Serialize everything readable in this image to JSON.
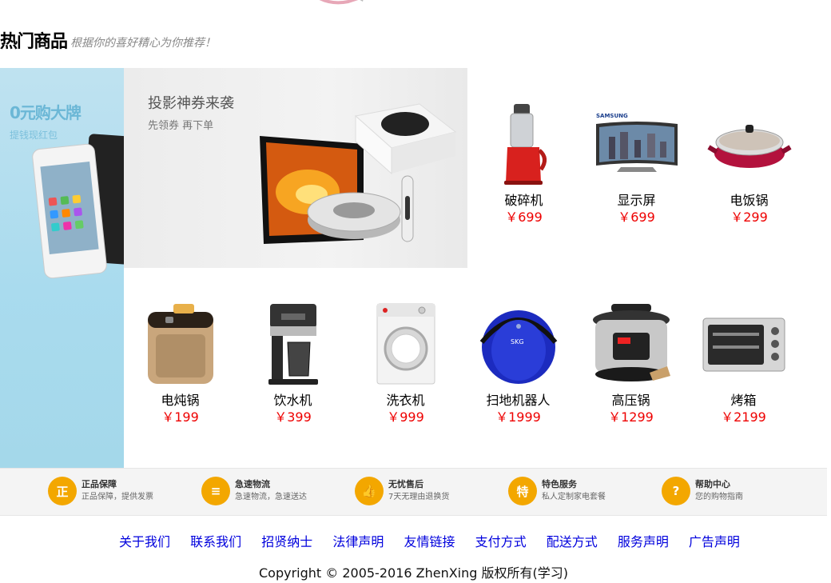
{
  "section": {
    "title": "热门商品",
    "slogan": "根据你的喜好精心为你推荐！"
  },
  "left_banner": {
    "title": "0元购大牌",
    "subtitle": "提钱现红包"
  },
  "promo_banner": {
    "title": "投影神券来袭",
    "subtitle": "先领券 再下单"
  },
  "products_row1": [
    {
      "name": "破碎机",
      "price": "￥699",
      "icon": "juicer-icon"
    },
    {
      "name": "显示屏",
      "price": "￥699",
      "icon": "monitor-icon"
    },
    {
      "name": "电饭锅",
      "price": "￥299",
      "icon": "hotpot-icon"
    }
  ],
  "products_row2": [
    {
      "name": "电炖锅",
      "price": "￥199",
      "icon": "bread-maker-icon"
    },
    {
      "name": "饮水机",
      "price": "￥399",
      "icon": "coffee-maker-icon"
    },
    {
      "name": "洗衣机",
      "price": "￥999",
      "icon": "washing-machine-icon"
    },
    {
      "name": "扫地机器人",
      "price": "￥1999",
      "icon": "robot-vacuum-icon"
    },
    {
      "name": "高压锅",
      "price": "￥1299",
      "icon": "pressure-cooker-icon"
    },
    {
      "name": "烤箱",
      "price": "￥2199",
      "icon": "oven-icon"
    }
  ],
  "services": [
    {
      "title": "正品保障",
      "desc": "正品保障，提供发票",
      "glyph": "正"
    },
    {
      "title": "急速物流",
      "desc": "急速物流，急速送达",
      "glyph": "≡"
    },
    {
      "title": "无忧售后",
      "desc": "7天无理由退换货",
      "glyph": "👍"
    },
    {
      "title": "特色服务",
      "desc": "私人定制家电套餐",
      "glyph": "特"
    },
    {
      "title": "帮助中心",
      "desc": "您的购物指南",
      "glyph": "?"
    }
  ],
  "footer": {
    "links": [
      "关于我们",
      "联系我们",
      "招贤纳士",
      "法律声明",
      "友情链接",
      "支付方式",
      "配送方式",
      "服务声明",
      "广告声明"
    ],
    "copyright": "Copyright © 2005-2016 ZhenXing 版权所有(学习)"
  },
  "colors": {
    "price": "#ee0000",
    "link": "#0000dd",
    "service_icon": "#f3a700"
  }
}
